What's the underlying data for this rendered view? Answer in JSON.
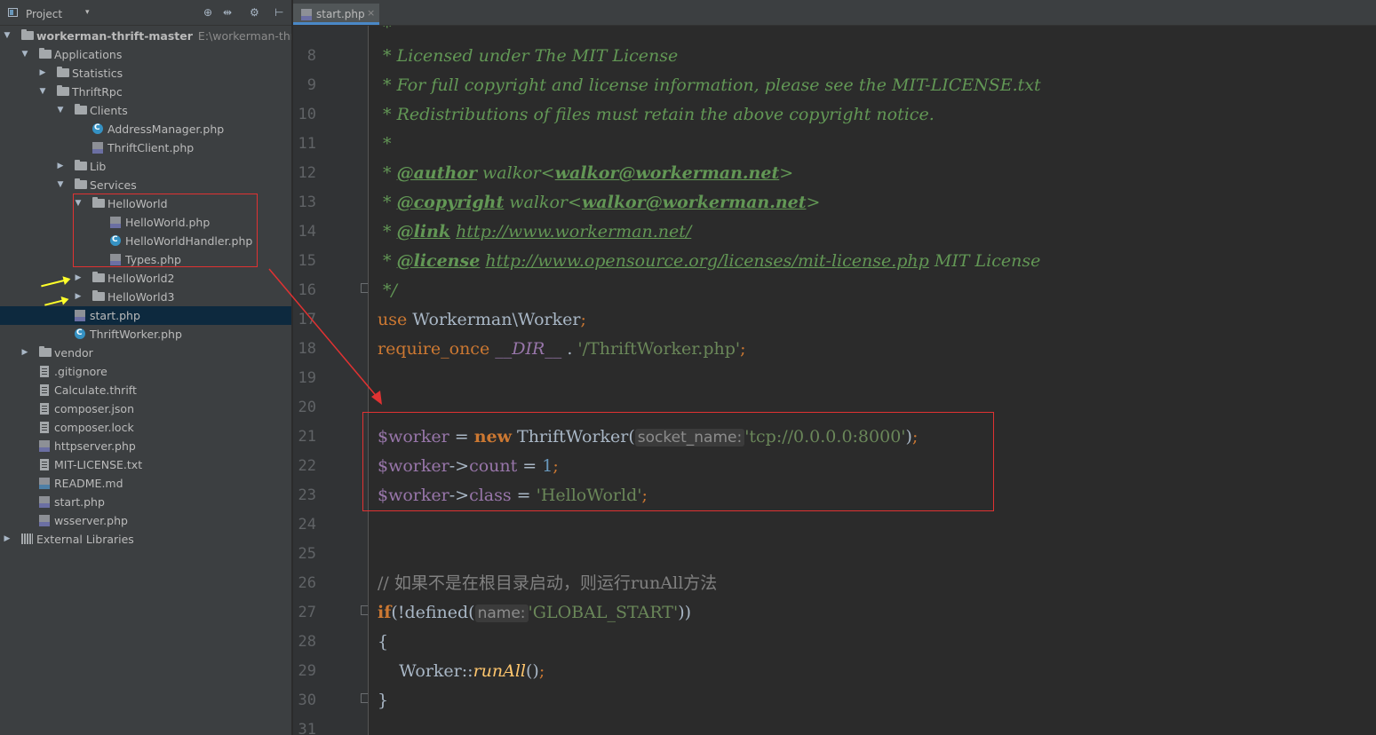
{
  "project_panel": {
    "header": {
      "title": "Project",
      "caret": "▾"
    },
    "tree": [
      {
        "label": "workerman-thrift-master",
        "path": "E:\\workerman-thrift-m"
      },
      {
        "label": "Applications"
      },
      {
        "label": "Statistics"
      },
      {
        "label": "ThriftRpc"
      },
      {
        "label": "Clients"
      },
      {
        "label": "AddressManager.php"
      },
      {
        "label": "ThriftClient.php"
      },
      {
        "label": "Lib"
      },
      {
        "label": "Services"
      },
      {
        "label": "HelloWorld"
      },
      {
        "label": "HelloWorld.php"
      },
      {
        "label": "HelloWorldHandler.php"
      },
      {
        "label": "Types.php"
      },
      {
        "label": "HelloWorld2"
      },
      {
        "label": "HelloWorld3"
      },
      {
        "label": "start.php"
      },
      {
        "label": "ThriftWorker.php"
      },
      {
        "label": "vendor"
      },
      {
        "label": ".gitignore"
      },
      {
        "label": "Calculate.thrift"
      },
      {
        "label": "composer.json"
      },
      {
        "label": "composer.lock"
      },
      {
        "label": "httpserver.php"
      },
      {
        "label": "MIT-LICENSE.txt"
      },
      {
        "label": "README.md"
      },
      {
        "label": "start.php"
      },
      {
        "label": "wsserver.php"
      },
      {
        "label": "External Libraries"
      }
    ]
  },
  "editor": {
    "tab": {
      "label": "start.php",
      "close": "×"
    },
    "line_numbers": [
      "8",
      "9",
      "10",
      "11",
      "12",
      "13",
      "14",
      "15",
      "16",
      "17",
      "18",
      "19",
      "20",
      "21",
      "22",
      "23",
      "24",
      "25",
      "26",
      "27",
      "28",
      "29",
      "30",
      "31"
    ],
    "code": {
      "l8": " * Licensed under The MIT License",
      "l9": " * For full copyright and license information, please see the MIT-LICENSE.txt",
      "l10": " * Redistributions of files must retain the above copyright notice.",
      "l11": " *",
      "l12_star": " * ",
      "l12_tag": "@author",
      "l12_name": " walkor<",
      "l12_mail": "walkor@workerman.net",
      "l12_end": ">",
      "l13_star": " * ",
      "l13_tag": "@copyright",
      "l13_name": " walkor<",
      "l13_mail": "walkor@workerman.net",
      "l13_end": ">",
      "l14_star": " * ",
      "l14_tag": "@link",
      "l14_sp": " ",
      "l14_url": "http://www.workerman.net/",
      "l15_star": " * ",
      "l15_tag": "@license",
      "l15_sp": " ",
      "l15_url": "http://www.opensource.org/licenses/mit-license.php",
      "l15_end": " MIT License",
      "l16": " */",
      "l17_kw": "use",
      "l17_ns": " Workerman\\Worker",
      "l17_semi": ";",
      "l18_kw": "require_once",
      "l18_sp": " ",
      "l18_const": "__DIR__",
      "l18_dot": " . ",
      "l18_str": "'/ThriftWorker.php'",
      "l18_semi": ";",
      "l21_var": "$worker",
      "l21_eq": " = ",
      "l21_new": "new",
      "l21_cls": " ThriftWorker(",
      "l21_hint": "socket_name:",
      "l21_str": "'tcp://0.0.0.0:8000'",
      "l21_close": ")",
      "l21_semi": ";",
      "l22_var": "$worker",
      "l22_arrow": "->",
      "l22_prop": "count",
      "l22_eq": " = ",
      "l22_num": "1",
      "l22_semi": ";",
      "l23_var": "$worker",
      "l23_arrow": "->",
      "l23_prop": "class",
      "l23_eq": " = ",
      "l23_str": "'HelloWorld'",
      "l23_semi": ";",
      "l26": "// 如果不是在根目录启动，则运行runAll方法",
      "l27_kw": "if",
      "l27_fn": "(!defined(",
      "l27_hint": "name:",
      "l27_str": "'GLOBAL_START'",
      "l27_close": "))",
      "l28": "{",
      "l29_cls": "    Worker::",
      "l29_fn": "runAll",
      "l29_paren": "()",
      "l29_semi": ";",
      "l30": "}"
    }
  },
  "colors": {
    "annotation_box": "#e03232",
    "annotation_yellow": "#ffff2a",
    "selected_row": "#0d293e"
  },
  "icons": [
    "project-view-icon",
    "locate-icon",
    "collapse-icon",
    "gear-icon",
    "hide-icon",
    "folder-icon",
    "php-class-icon",
    "php-file-icon",
    "text-file-icon",
    "markdown-file-icon",
    "library-icon",
    "fold-marker-icon"
  ]
}
